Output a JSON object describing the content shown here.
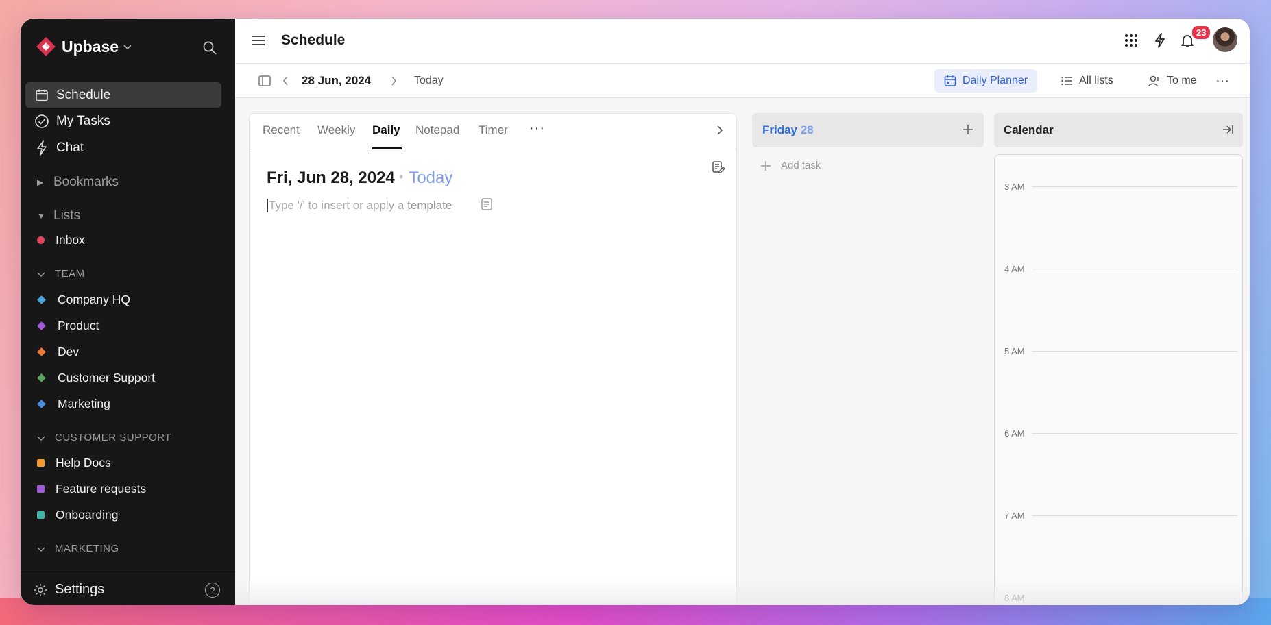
{
  "app": {
    "name": "Upbase"
  },
  "sidebar": {
    "nav": [
      {
        "label": "Schedule",
        "icon": "calendar-icon",
        "active": true
      },
      {
        "label": "My Tasks",
        "icon": "check-circle-icon"
      },
      {
        "label": "Chat",
        "icon": "bolt-icon"
      }
    ],
    "bookmarks_label": "Bookmarks",
    "lists_label": "Lists",
    "inbox_label": "Inbox",
    "groups": [
      {
        "title": "TEAM",
        "items": [
          {
            "label": "Company HQ",
            "color": "#4aa3d8"
          },
          {
            "label": "Product",
            "color": "#a35ad8"
          },
          {
            "label": "Dev",
            "color": "#ef7a35"
          },
          {
            "label": "Customer Support",
            "color": "#5aa35a"
          },
          {
            "label": "Marketing",
            "color": "#4a8fe0"
          }
        ]
      },
      {
        "title": "CUSTOMER SUPPORT",
        "items": [
          {
            "label": "Help Docs",
            "color": "#f29a2e"
          },
          {
            "label": "Feature requests",
            "color": "#a35ad8"
          },
          {
            "label": "Onboarding",
            "color": "#3fb3a8"
          }
        ]
      },
      {
        "title": "MARKETING",
        "items": []
      }
    ],
    "settings_label": "Settings",
    "help_label": "?"
  },
  "topbar": {
    "title": "Schedule",
    "notification_count": "23"
  },
  "subbar": {
    "date": "28 Jun, 2024",
    "today": "Today",
    "views": [
      {
        "label": "Daily Planner",
        "active": true
      },
      {
        "label": "All lists"
      },
      {
        "label": "To me"
      }
    ]
  },
  "notes": {
    "tabs": [
      "Recent",
      "Weekly",
      "Daily",
      "Notepad",
      "Timer"
    ],
    "active_tab": "Daily",
    "more": "···",
    "date_heading": "Fri, Jun 28, 2024",
    "today_label": "Today",
    "placeholder_prefix": "Type '/' to insert or apply a ",
    "placeholder_link": "template"
  },
  "day": {
    "weekday": "Friday",
    "day_num": "28",
    "add_task": "Add task"
  },
  "calendar": {
    "title": "Calendar",
    "hours": [
      "3 AM",
      "4 AM",
      "5 AM",
      "6 AM",
      "7 AM",
      "8 AM"
    ]
  },
  "colors": {
    "brand": "#d8344f",
    "accent": "#2e5fd8",
    "sidebar_bg": "#171717",
    "inbox_dot": "#e0455f"
  }
}
